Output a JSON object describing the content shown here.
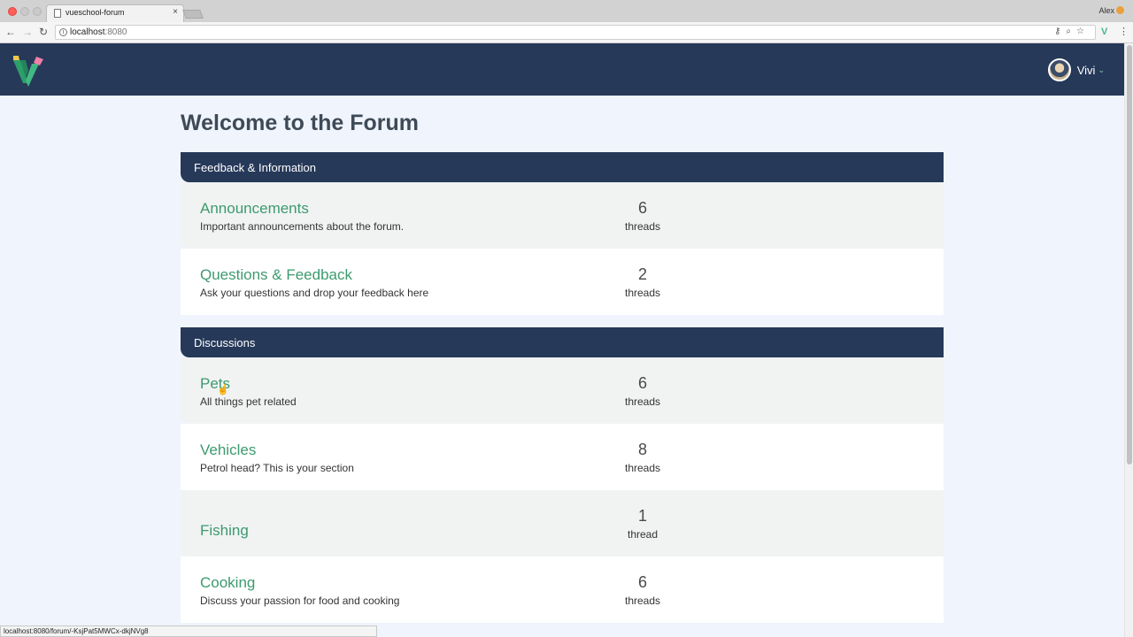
{
  "browser": {
    "tab_title": "vueschool-forum",
    "tab_close": "×",
    "profile_name": "Alex",
    "url_host": "localhost",
    "url_port": ":8080",
    "back": "←",
    "forward": "→",
    "reload": "↻",
    "status_url": "localhost:8080/forum/-KsjPat5MWCx-dkjNVg8"
  },
  "header": {
    "user_name": "Vivi",
    "caret": "⌄"
  },
  "page": {
    "title": "Welcome to the Forum"
  },
  "categories": [
    {
      "name": "Feedback & Information",
      "forums": [
        {
          "name": "Announcements",
          "description": "Important announcements about the forum.",
          "count": "6",
          "label": "threads"
        },
        {
          "name": "Questions & Feedback",
          "description": "Ask your questions and drop your feedback here",
          "count": "2",
          "label": "threads"
        }
      ]
    },
    {
      "name": "Discussions",
      "forums": [
        {
          "name": "Pets",
          "description": "All things pet related",
          "count": "6",
          "label": "threads"
        },
        {
          "name": "Vehicles",
          "description": "Petrol head? This is your section",
          "count": "8",
          "label": "threads"
        },
        {
          "name": "Fishing",
          "description": "",
          "count": "1",
          "label": "thread"
        },
        {
          "name": "Cooking",
          "description": "Discuss your passion for food and cooking",
          "count": "6",
          "label": "threads"
        }
      ]
    }
  ],
  "colors": {
    "navy": "#263959",
    "accent_green": "#3d9a6f",
    "page_bg": "#f0f4fc"
  }
}
